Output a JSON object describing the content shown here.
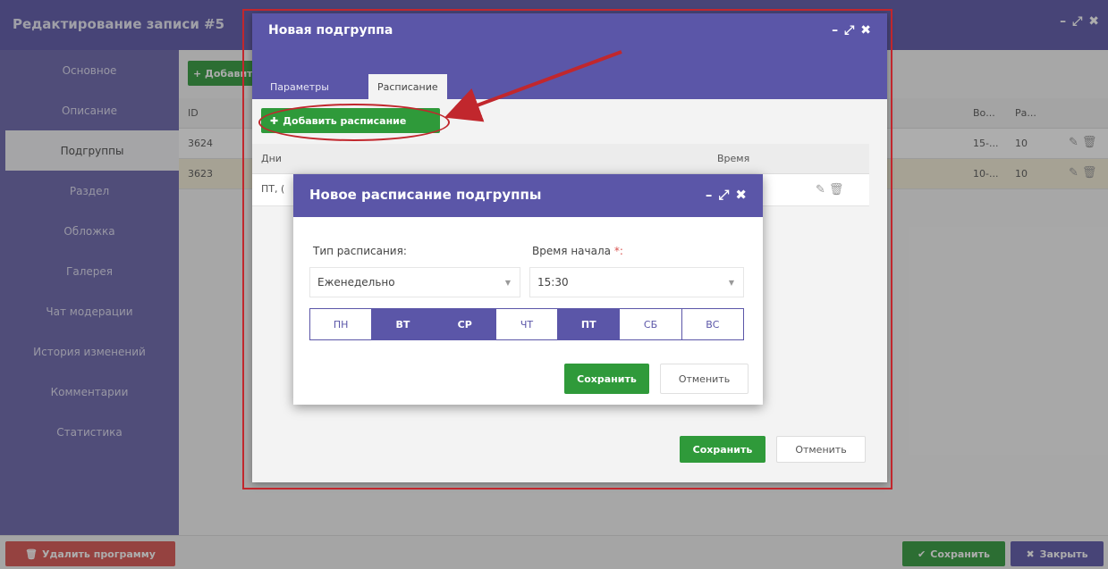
{
  "outer": {
    "title": "Редактирование записи #5",
    "sidebar": [
      {
        "label": "Основное",
        "active": false
      },
      {
        "label": "Описание",
        "active": false
      },
      {
        "label": "Подгруппы",
        "active": true
      },
      {
        "label": "Раздел",
        "active": false
      },
      {
        "label": "Обложка",
        "active": false
      },
      {
        "label": "Галерея",
        "active": false
      },
      {
        "label": "Чат модерации",
        "active": false
      },
      {
        "label": "История изменений",
        "active": false
      },
      {
        "label": "Комментарии",
        "active": false
      },
      {
        "label": "Статистика",
        "active": false
      }
    ],
    "add_button": "+ Добавить",
    "grid": {
      "headers": {
        "id": "ID",
        "col_bo": "Во...",
        "col_pa": "Ра..."
      },
      "rows": [
        {
          "id": "3624",
          "bo": "15-...",
          "pa": "10"
        },
        {
          "id": "3623",
          "bo": "10-...",
          "pa": "10"
        }
      ]
    },
    "footer": {
      "delete_program": "Удалить программу",
      "save": "Сохранить",
      "close": "Закрыть"
    },
    "window_controls": {
      "minimize": "–",
      "maximize": "⤢",
      "close": "✖"
    }
  },
  "subgroup_dialog": {
    "title": "Новая подгруппа",
    "tabs": [
      {
        "label": "Параметры",
        "active": false
      },
      {
        "label": "Расписание",
        "active": true
      }
    ],
    "add_schedule": "Добавить расписание",
    "table": {
      "headers": {
        "days": "Дни",
        "time": "Время"
      },
      "rows": [
        {
          "days": "ПТ, ("
        }
      ]
    },
    "save": "Сохранить",
    "cancel": "Отменить"
  },
  "schedule_dialog": {
    "title": "Новое расписание подгруппы",
    "type_label": "Тип расписания:",
    "type_value": "Еженедельно",
    "start_label": "Время начала ",
    "start_required": "*:",
    "start_value": "15:30",
    "days": [
      {
        "label": "ПН",
        "selected": false
      },
      {
        "label": "ВТ",
        "selected": true
      },
      {
        "label": "СР",
        "selected": true
      },
      {
        "label": "ЧТ",
        "selected": false
      },
      {
        "label": "ПТ",
        "selected": true
      },
      {
        "label": "СБ",
        "selected": false
      },
      {
        "label": "ВС",
        "selected": false
      }
    ],
    "save": "Сохранить",
    "cancel": "Отменить"
  },
  "icons": {
    "plus": "✚",
    "pencil": "✎",
    "trash": "🗑",
    "check": "✔",
    "cross": "✖",
    "caret": "▼"
  },
  "colors": {
    "header_purple": "#5b56a8",
    "sidebar_purple": "#6964ac",
    "green": "#2f9a3a",
    "red": "#d9534f",
    "annotation_red": "#c1272d",
    "highlight_row": "#f4edd7"
  }
}
